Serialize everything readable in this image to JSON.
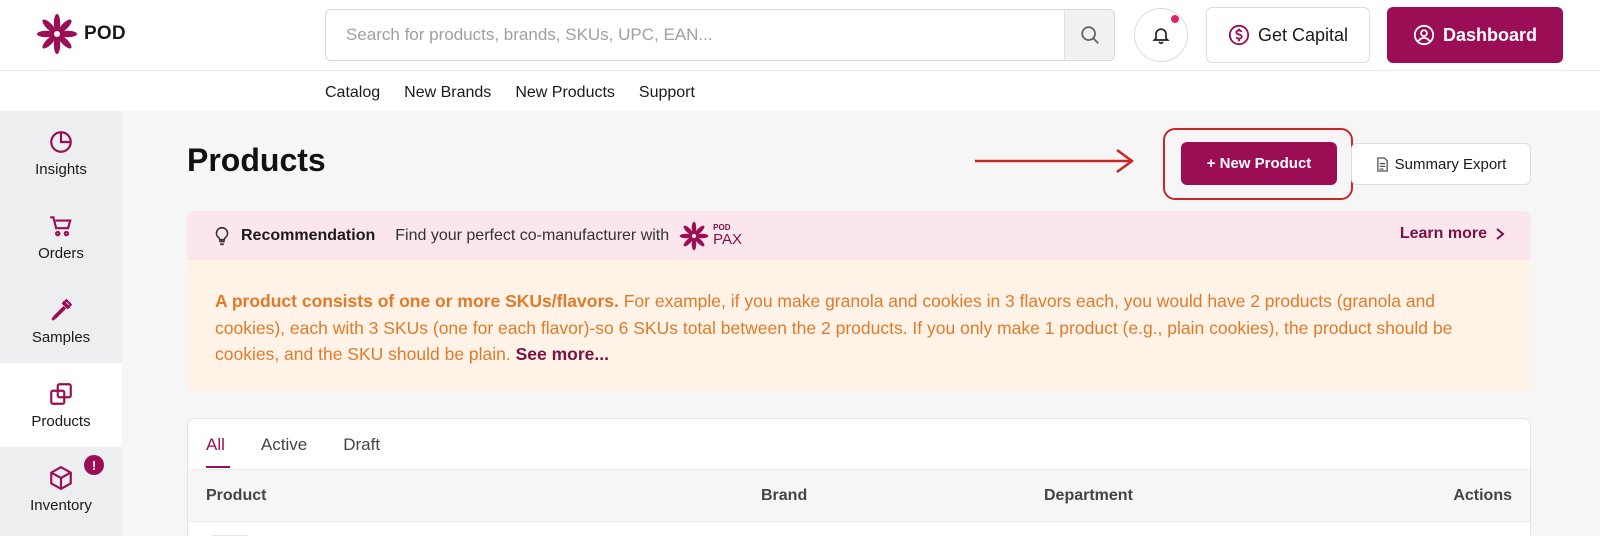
{
  "header": {
    "logo_text": "POD",
    "search_placeholder": "Search for products, brands, SKUs, UPC, EAN...",
    "capital_label": "Get Capital",
    "dashboard_label": "Dashboard"
  },
  "subnav": [
    "Catalog",
    "New Brands",
    "New Products",
    "Support"
  ],
  "sidebar": {
    "items": [
      {
        "label": "Insights",
        "icon": "pie-chart-icon"
      },
      {
        "label": "Orders",
        "icon": "cart-icon"
      },
      {
        "label": "Samples",
        "icon": "dropper-icon"
      },
      {
        "label": "Products",
        "icon": "copy-icon",
        "active": true
      },
      {
        "label": "Inventory",
        "icon": "box-icon",
        "badge": "!"
      }
    ]
  },
  "page": {
    "title": "Products",
    "new_product_label": "+ New Product",
    "summary_export_label": "Summary Export"
  },
  "recommendation": {
    "title": "Recommendation",
    "text": "Find your perfect co-manufacturer with",
    "logo_small": "POD",
    "logo_big": "PAX",
    "learn_more": "Learn more"
  },
  "info": {
    "lead": "A product consists of one or more SKUs/flavors.",
    "body": " For example, if you make granola and cookies in 3 flavors each, you would have 2 products (granola and cookies), each with 3 SKUs (one for each flavor)-so 6 SKUs total between the 2 products. If you only make 1 product (e.g., plain cookies), the product should be cookies, and the SKU should be plain. ",
    "see_more": "See more..."
  },
  "table": {
    "tabs": [
      "All",
      "Active",
      "Draft"
    ],
    "columns": [
      "Product",
      "Brand",
      "Department",
      "Actions"
    ]
  },
  "colors": {
    "brand": "#9b0d55",
    "highlight": "#c62828",
    "info_text": "#e07b2c"
  }
}
